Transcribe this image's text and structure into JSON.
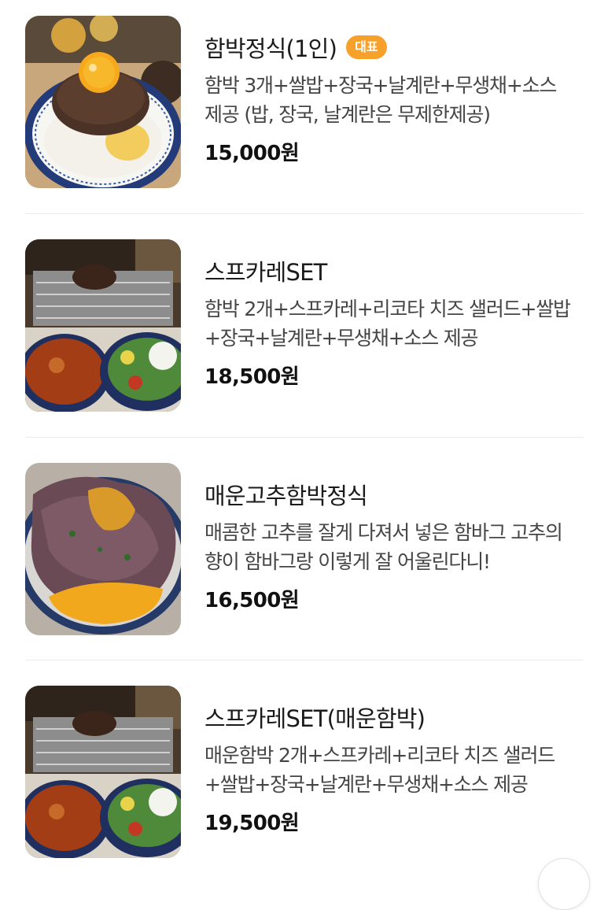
{
  "menu": {
    "items": [
      {
        "name": "함박정식(1인)",
        "badge": "대표",
        "description": "함박 3개+쌀밥+장국+날계란+무생채+소스 제공 (밥, 장국, 날계란은 무제한제공)",
        "price": "15,000원",
        "image": "hamburg-steak-rice-egg-photo"
      },
      {
        "name": "스프카레SET",
        "description": "함박 2개+스프카레+리코타 치즈 샐러드+쌀밥+장국+날계란+무생채+소스 제공",
        "price": "18,500원",
        "image": "soup-curry-set-photo"
      },
      {
        "name": "매운고추함박정식",
        "description": "매콤한 고추를 잘게 다져서 넣은 함바그 고추의 향이 함바그랑 이렇게 잘 어울린다니!",
        "price": "16,500원",
        "image": "spicy-pepper-hamburg-photo"
      },
      {
        "name": "스프카레SET(매운함박)",
        "description": "매운함박 2개+스프카레+리코타 치즈 샐러드+쌀밥+장국+날계란+무생채+소스 제공",
        "price": "19,500원",
        "image": "soup-curry-set-spicy-photo"
      }
    ]
  },
  "colors": {
    "badge": "#f7a02a",
    "divider": "#ececec",
    "price": "#111111",
    "description": "#454545"
  }
}
